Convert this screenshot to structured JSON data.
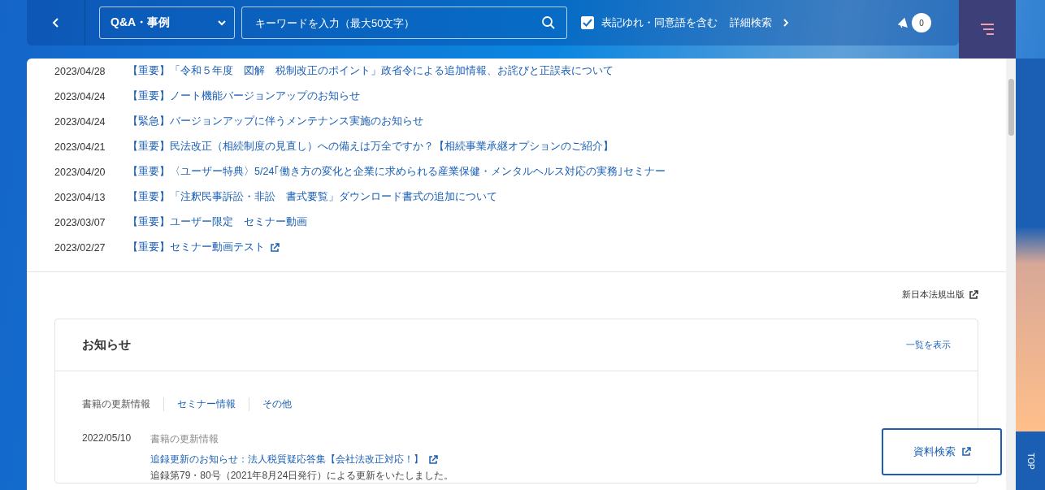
{
  "header": {
    "category_select": {
      "value": "Q&A・事例"
    },
    "search": {
      "placeholder": "キーワードを入力（最大50文字）"
    },
    "variant_option": {
      "label": "表記ゆれ・同意語を含む",
      "checked": true
    },
    "advanced_search": "詳細検索",
    "notification_count": "0"
  },
  "news": [
    {
      "date": "2023/04/28",
      "title": "【重要】「令和５年度　図解　税制改正のポイント」政省令による追加情報、お詫びと正誤表について",
      "external": false
    },
    {
      "date": "2023/04/24",
      "title": "【重要】ノート機能バージョンアップのお知らせ",
      "external": false
    },
    {
      "date": "2023/04/24",
      "title": "【緊急】バージョンアップに伴うメンテナンス実施のお知らせ",
      "external": false
    },
    {
      "date": "2023/04/21",
      "title": "【重要】民法改正（相続制度の見直し）への備えは万全ですか？【相続事業承継オプションのご紹介】",
      "external": false
    },
    {
      "date": "2023/04/20",
      "title": "【重要】〈ユーザー特典〉5/24｢働き方の変化と企業に求められる産業保健・メンタルヘルス対応の実務｣セミナー",
      "external": false
    },
    {
      "date": "2023/04/13",
      "title": "【重要】「注釈民事訴訟・非訟　書式要覧」ダウンロード書式の追加について",
      "external": false
    },
    {
      "date": "2023/03/07",
      "title": "【重要】ユーザー限定　セミナー動画",
      "external": false
    },
    {
      "date": "2023/02/27",
      "title": "【重要】セミナー動画テスト",
      "external": true
    }
  ],
  "publisher_link": "新日本法規出版",
  "notices": {
    "title": "お知らせ",
    "view_all": "一覧を表示",
    "tabs": [
      {
        "label": "書籍の更新情報",
        "selected": true
      },
      {
        "label": "セミナー情報",
        "selected": false
      },
      {
        "label": "その他",
        "selected": false
      }
    ],
    "items": [
      {
        "date": "2022/05/10",
        "category": "書籍の更新情報",
        "title": "追録更新のお知らせ：法人税質疑応答集【会社法改正対応！】",
        "external": true,
        "description": "追録第79・80号（2021年8月24日発行）による更新をいたしました。"
      }
    ]
  },
  "floating_button": "資料検索",
  "top_button": "TOP"
}
